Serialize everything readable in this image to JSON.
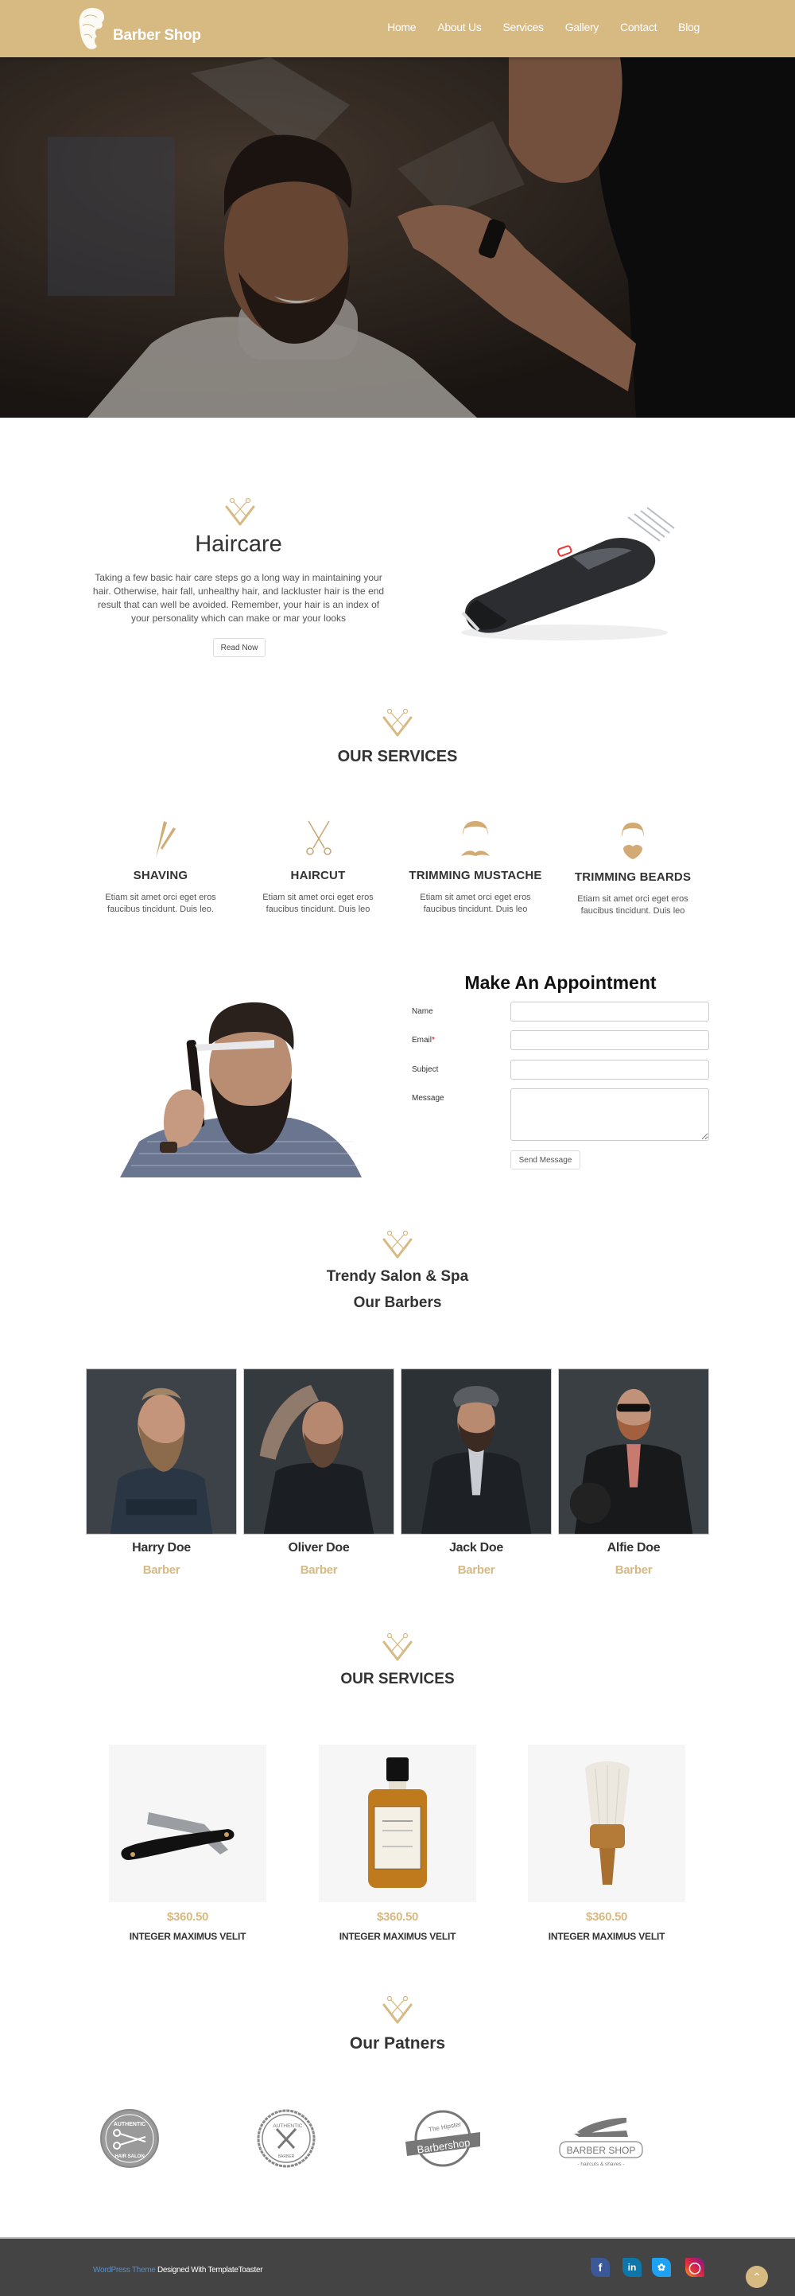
{
  "header": {
    "brand": "Barber Shop",
    "nav": [
      "Home",
      "About Us",
      "Services",
      "Gallery",
      "Contact",
      "Blog"
    ]
  },
  "haircare": {
    "title": "Haircare",
    "text": "Taking a few basic hair care steps go a long way in maintaining your hair. Otherwise, hair fall, unhealthy hair, and lackluster hair is the end result that can well be avoided. Remember, your hair is an index of your personality which can make or mar your looks",
    "button": "Read Now"
  },
  "services": {
    "heading": "OUR SERVICES",
    "items": [
      {
        "title": "SHAVING",
        "text": "Etiam sit amet orci eget eros faucibus tincidunt. Duis leo.",
        "icon": "razor-icon"
      },
      {
        "title": "HAIRCUT",
        "text": "Etiam sit amet orci eget eros faucibus tincidunt. Duis leo",
        "icon": "scissors-icon"
      },
      {
        "title": "TRIMMING MUSTACHE",
        "text": "Etiam sit amet orci eget eros faucibus tincidunt. Duis leo",
        "icon": "mustache-icon"
      },
      {
        "title": "TRIMMING BEARDS",
        "text": "Etiam sit amet orci eget eros faucibus tincidunt. Duis leo",
        "icon": "beard-icon"
      }
    ]
  },
  "appointment": {
    "title": "Make An Appointment",
    "fields": {
      "name": {
        "label": "Name",
        "value": ""
      },
      "email": {
        "label": "Email",
        "required_mark": "*",
        "value": ""
      },
      "subject": {
        "label": "Subject",
        "value": ""
      },
      "message": {
        "label": "Message",
        "value": ""
      }
    },
    "submit": "Send Message"
  },
  "barbers": {
    "subtitle": "Trendy Salon & Spa",
    "heading": "Our Barbers",
    "items": [
      {
        "name": "Harry Doe",
        "role": "Barber"
      },
      {
        "name": "Oliver Doe",
        "role": "Barber"
      },
      {
        "name": "Jack Doe",
        "role": "Barber"
      },
      {
        "name": "Alfie Doe",
        "role": "Barber"
      }
    ]
  },
  "products": {
    "heading": "OUR SERVICES",
    "items": [
      {
        "price": "$360.50",
        "name": "INTEGER MAXIMUS VELIT",
        "image": "straight-razor"
      },
      {
        "price": "$360.50",
        "name": "INTEGER MAXIMUS VELIT",
        "image": "shampoo-bottle"
      },
      {
        "price": "$360.50",
        "name": "INTEGER MAXIMUS VELIT",
        "image": "neck-brush"
      }
    ]
  },
  "partners": {
    "heading": "Our Patners",
    "logos": [
      {
        "top": "AUTHENTIC",
        "bottom": "HAIR SALON"
      },
      {
        "top": "AUTHENTIC",
        "bottom": "BARBER"
      },
      {
        "top": "The Hipster",
        "bottom": "Barbershop"
      },
      {
        "top": "BARBER SHOP",
        "bottom": "- haircuts & shaves -"
      }
    ]
  },
  "footer": {
    "link_text": "WordPress Theme",
    "text": " Designed With TemplateToaster",
    "social": [
      "facebook",
      "linkedin",
      "twitter",
      "instagram"
    ]
  },
  "colors": {
    "accent": "#d7b982",
    "footer_bg": "#444444",
    "link": "#5a8fc8"
  }
}
